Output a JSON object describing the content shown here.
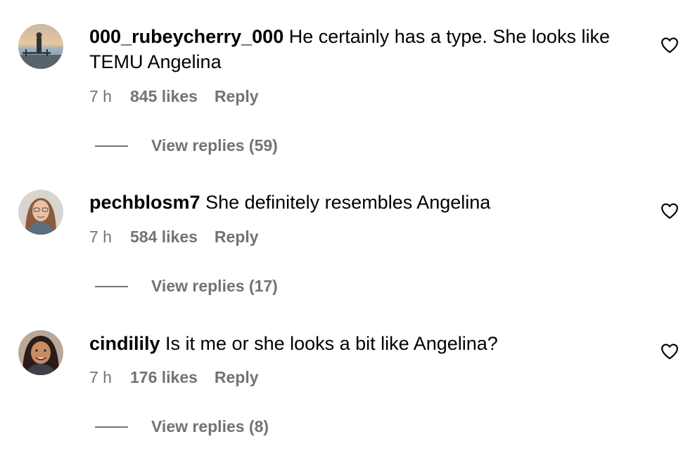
{
  "comments": [
    {
      "username": "000_rubeycherry_000",
      "text": "He certainly has a type. She looks like TEMU Angelina",
      "time": "7 h",
      "likes": "845 likes",
      "reply_label": "Reply",
      "view_replies": "View replies (59)",
      "avatar": "avatar-photo-person-on-pier-at-sunset",
      "like_icon": "heart-outline-icon"
    },
    {
      "username": "pechblosm7",
      "text": "She definitely resembles Angelina",
      "time": "7 h",
      "likes": "584 likes",
      "reply_label": "Reply",
      "view_replies": "View replies (17)",
      "avatar": "avatar-photo-woman-with-long-hair",
      "like_icon": "heart-outline-icon"
    },
    {
      "username": "cindilily",
      "text": "Is it me or she looks a bit like Angelina?",
      "time": "7 h",
      "likes": "176 likes",
      "reply_label": "Reply",
      "view_replies": "View replies (8)",
      "avatar": "avatar-photo-smiling-woman",
      "like_icon": "heart-outline-icon"
    }
  ],
  "colors": {
    "text": "#000000",
    "secondary": "#737373",
    "background": "#ffffff"
  }
}
